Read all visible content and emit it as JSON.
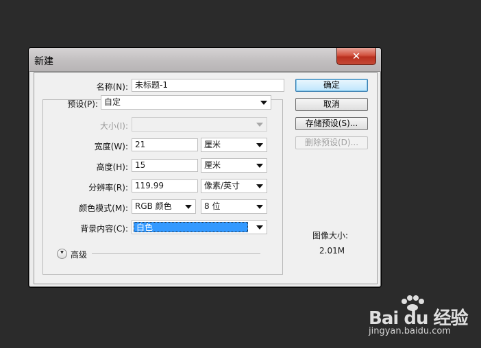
{
  "dialog": {
    "title": "新建",
    "close_glyph": "✕"
  },
  "fields": {
    "name": {
      "label": "名称(N):",
      "value": "未标题-1"
    },
    "preset": {
      "label": "预设(P):",
      "value": "自定"
    },
    "size": {
      "label": "大小(I):",
      "value": ""
    },
    "width": {
      "label": "宽度(W):",
      "value": "21",
      "unit": "厘米"
    },
    "height": {
      "label": "高度(H):",
      "value": "15",
      "unit": "厘米"
    },
    "resolution": {
      "label": "分辨率(R):",
      "value": "119.99",
      "unit": "像素/英寸"
    },
    "color_mode": {
      "label": "颜色模式(M):",
      "value": "RGB 颜色",
      "depth": "8 位"
    },
    "background": {
      "label": "背景内容(C):",
      "value": "白色"
    },
    "advanced": {
      "label": "高级",
      "icon": "chevron-double-down-icon"
    }
  },
  "buttons": {
    "ok": "确定",
    "cancel": "取消",
    "save_preset": "存储预设(S)...",
    "delete_preset": "删除预设(D)..."
  },
  "image_size": {
    "label": "图像大小:",
    "value": "2.01M"
  },
  "watermark": {
    "logo": "Bai du 经验",
    "url": "jingyan.baidu.com"
  },
  "colors": {
    "background": "#2b2b2b",
    "dialog": "#f0f0f0",
    "close_button": "#c7442f",
    "selection": "#3399ff",
    "default_button": "#bee6fd"
  }
}
